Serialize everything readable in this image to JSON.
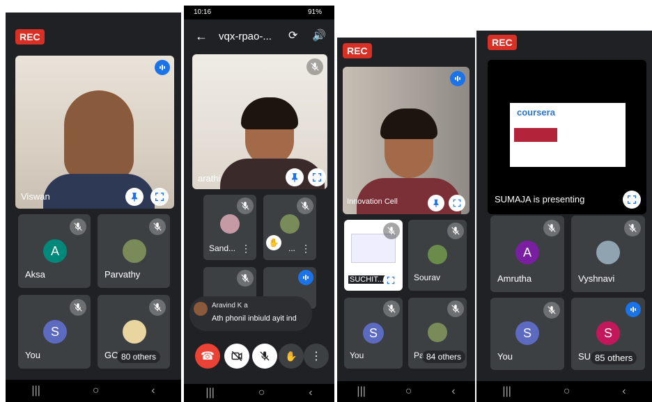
{
  "panel1": {
    "rec": "REC",
    "main_name": "Viswan",
    "tiles": [
      {
        "letter": "A",
        "name": "Aksa",
        "color": "#00897b"
      },
      {
        "name": "Parvathy"
      },
      {
        "letter": "S",
        "name": "You",
        "color": "#5c6bc0"
      },
      {
        "name": "GC",
        "others": "80 others"
      }
    ]
  },
  "panel2": {
    "status_time": "10:16",
    "status_right": "91%",
    "meeting_code": "vqx-rpao-...",
    "main_name": "arathi",
    "tiles": [
      {
        "name": "Sand..."
      },
      {
        "name": "..."
      }
    ],
    "chat": {
      "sender": "Aravind K a",
      "message": "Ath phonil inbiuld ayit ind"
    }
  },
  "panel3": {
    "rec": "REC",
    "main_name": "Innovation Cell",
    "tiles": [
      {
        "name": "SUCHIT..."
      },
      {
        "name": "Sourav"
      },
      {
        "letter": "S",
        "name": "You",
        "color": "#5c6bc0"
      },
      {
        "name": "Pa",
        "others": "84 others"
      }
    ]
  },
  "panel4": {
    "rec": "REC",
    "presenting": "SUMAJA is presenting",
    "slide_brand": "coursera",
    "tiles": [
      {
        "letter": "A",
        "name": "Amrutha",
        "color": "#7b1fa2"
      },
      {
        "name": "Vyshnavi"
      },
      {
        "letter": "S",
        "name": "You",
        "color": "#5c6bc0"
      },
      {
        "letter": "S",
        "name": "SU",
        "others": "85 others",
        "color": "#c2185b"
      }
    ]
  },
  "colors": {
    "rec": "#d93025",
    "speaking": "#1a73e8",
    "end_call": "#ea4335"
  }
}
